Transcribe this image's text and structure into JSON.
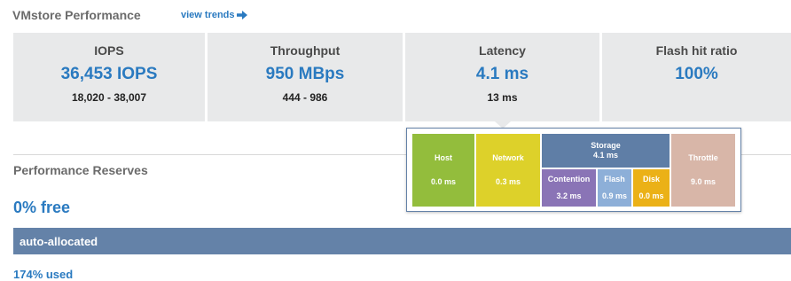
{
  "header": {
    "title": "VMstore Performance",
    "trends_link": "view trends"
  },
  "stats": [
    {
      "label": "IOPS",
      "value": "36,453 IOPS",
      "range": "18,020 - 38,007"
    },
    {
      "label": "Throughput",
      "value": "950 MBps",
      "range": "444 - 986"
    },
    {
      "label": "Latency",
      "value": "4.1 ms",
      "range": "13 ms"
    },
    {
      "label": "Flash hit ratio",
      "value": "100%",
      "range": ""
    }
  ],
  "latency_breakdown": {
    "host": {
      "label": "Host",
      "value": "0.0 ms",
      "color": "#93bd3c"
    },
    "network": {
      "label": "Network",
      "value": "0.3 ms",
      "color": "#ddd12a"
    },
    "storage": {
      "label": "Storage",
      "value": "4.1 ms",
      "color": "#5f7ea6"
    },
    "contention": {
      "label": "Contention",
      "value": "3.2 ms",
      "color": "#8a74b6"
    },
    "flash": {
      "label": "Flash",
      "value": "0.9 ms",
      "color": "#8dafd8"
    },
    "disk": {
      "label": "Disk",
      "value": "0.0 ms",
      "color": "#ebb117"
    },
    "throttle": {
      "label": "Throttle",
      "value": "9.0 ms",
      "color": "#d8b6a8"
    }
  },
  "reserves": {
    "title": "Performance Reserves",
    "free": "0% free",
    "allocation": "auto-allocated",
    "used": "174% used"
  },
  "colors": {
    "accent": "#2a7ac0",
    "card_bg": "#e8e9ea",
    "allocation_bar": "#6482a8"
  }
}
